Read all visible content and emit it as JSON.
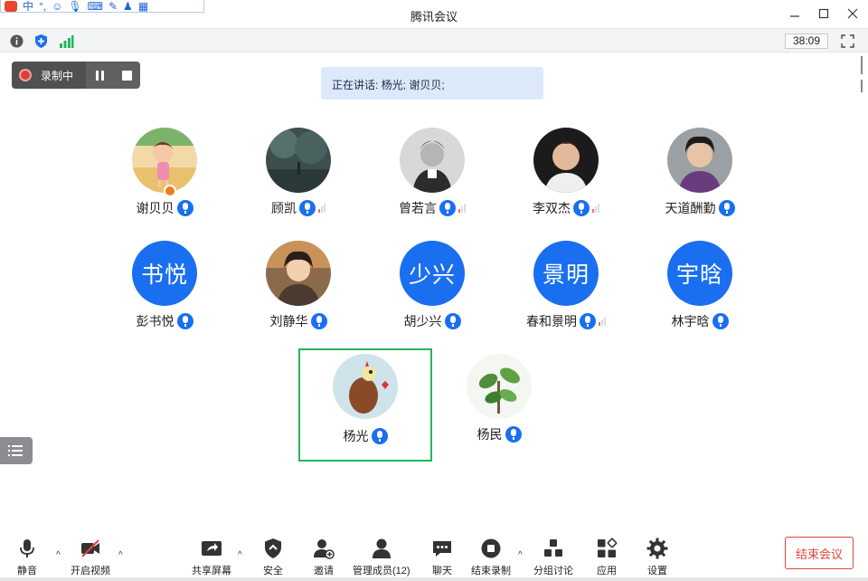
{
  "window": {
    "title": "腾讯会议",
    "timer": "38:09"
  },
  "ime": {
    "mode": "中"
  },
  "recording": {
    "label": "录制中"
  },
  "speaking": {
    "text": "正在讲话: 杨光; 谢贝贝;"
  },
  "participants": [
    {
      "name": "谢贝贝",
      "avatar": "photo",
      "signal": false
    },
    {
      "name": "顾凯",
      "avatar": "photo",
      "signal": true
    },
    {
      "name": "曾若言",
      "avatar": "photo",
      "signal": true
    },
    {
      "name": "李双杰",
      "avatar": "photo",
      "signal": true
    },
    {
      "name": "天道酬勤",
      "avatar": "photo",
      "signal": false
    },
    {
      "name": "彭书悦",
      "avatar_text": "书悦",
      "signal": false
    },
    {
      "name": "刘静华",
      "avatar": "photo",
      "signal": false
    },
    {
      "name": "胡少兴",
      "avatar_text": "少兴",
      "signal": false
    },
    {
      "name": "春和景明",
      "avatar_text": "景明",
      "signal": true
    },
    {
      "name": "林宇晗",
      "avatar_text": "宇晗",
      "signal": false
    },
    {
      "name": "杨光",
      "avatar": "photo",
      "signal": false,
      "active": true
    },
    {
      "name": "杨民",
      "avatar": "photo",
      "signal": false
    }
  ],
  "toolbar": {
    "mute": "静音",
    "video": "开启视频",
    "share": "共享屏幕",
    "security": "安全",
    "invite": "邀请",
    "members": "管理成员(12)",
    "chat": "聊天",
    "end_record": "结束录制",
    "breakout": "分组讨论",
    "apps": "应用",
    "settings": "设置",
    "end_meeting": "结束会议"
  },
  "colors": {
    "accent": "#1a6ff0",
    "active_border": "#26b45d",
    "danger": "#e1453a"
  }
}
